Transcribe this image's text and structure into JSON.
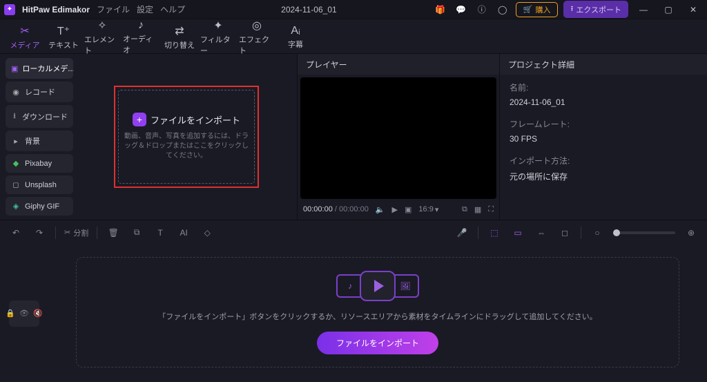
{
  "titlebar": {
    "app_name": "HitPaw Edimakor",
    "menu_file": "ファイル",
    "menu_settings": "設定",
    "menu_help": "ヘルプ",
    "project_name": "2024-11-06_01",
    "buy_label": "購入",
    "export_label": "エクスポート"
  },
  "tooltabs": {
    "media": "メディア",
    "text": "テキスト",
    "element": "エレメント",
    "audio": "オーディオ",
    "transition": "切り替え",
    "filter": "フィルター",
    "effect": "エフェクト",
    "caption": "字幕"
  },
  "media_panel": {
    "items": {
      "local": "ローカルメデ...",
      "record": "レコード",
      "download": "ダウンロード",
      "background": "背景",
      "pixabay": "Pixabay",
      "unsplash": "Unsplash",
      "giphy": "Giphy GIF"
    },
    "import_title": "ファイルをインポート",
    "import_sub": "動画、音声、写真を追加するには、ドラッグ＆ドロップまたはここをクリックしてください。"
  },
  "player": {
    "title": "プレイヤー",
    "time_current": "00:00:00",
    "time_total": "00:00:00",
    "aspect": "16:9"
  },
  "details": {
    "title": "プロジェクト詳細",
    "name_label": "名前:",
    "name_value": "2024-11-06_01",
    "fps_label": "フレームレート:",
    "fps_value": "30 FPS",
    "import_label": "インポート方法:",
    "import_value": "元の場所に保存"
  },
  "tl_toolbar": {
    "split": "分割"
  },
  "timeline": {
    "message": "「ファイルをインポート」ボタンをクリックするか、リソースエリアから素材をタイムラインにドラッグして追加してください。",
    "button": "ファイルをインポート"
  }
}
